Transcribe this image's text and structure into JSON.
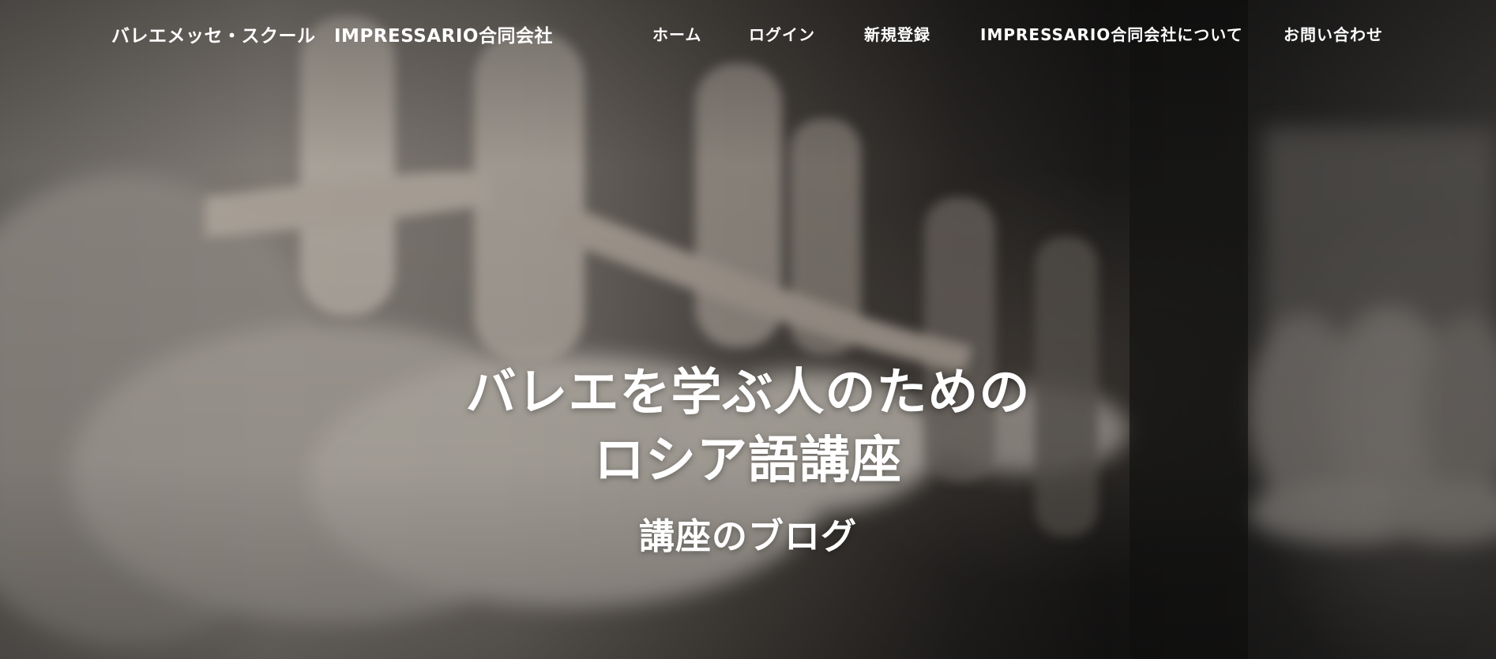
{
  "header": {
    "brand": "バレエメッセ・スクール　IMPRESSARIO合同会社",
    "nav": [
      {
        "label": "ホーム"
      },
      {
        "label": "ログイン"
      },
      {
        "label": "新規登録"
      },
      {
        "label": "IMPRESSARIO合同会社について"
      },
      {
        "label": "お問い合わせ"
      }
    ]
  },
  "hero": {
    "title_line1": "バレエを学ぶ人のための",
    "title_line2": "ロシア語講座",
    "subtitle": "講座のブログ",
    "background": "ballet-dancers-photo"
  },
  "colors": {
    "text": "#ffffff",
    "dark_bg": "#141414"
  }
}
